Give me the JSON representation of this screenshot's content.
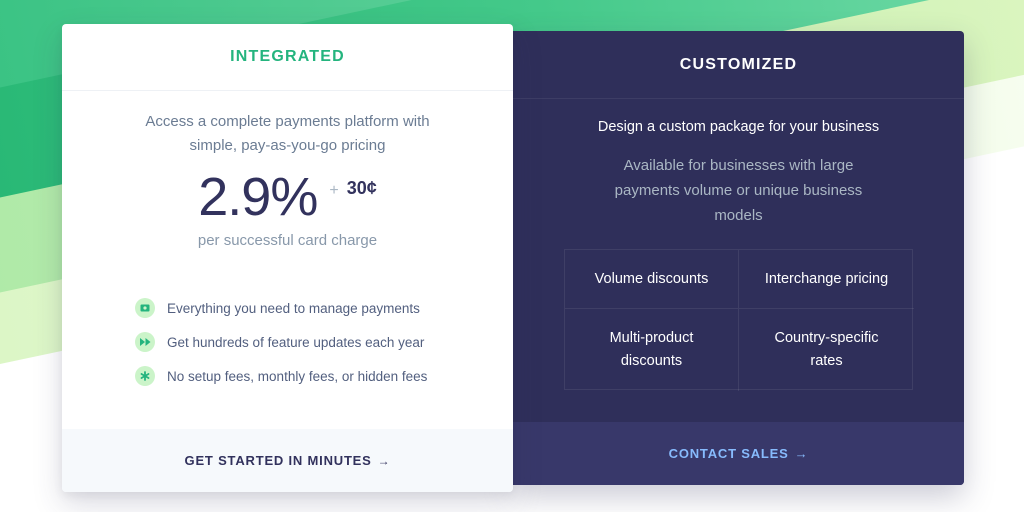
{
  "integrated": {
    "title": "INTEGRATED",
    "description": "Access a complete payments platform with simple, pay-as-you-go pricing",
    "price_percent": "2.9%",
    "price_plus": "+",
    "price_fixed": "30¢",
    "price_caption": "per successful card charge",
    "features": [
      {
        "icon": "money-icon",
        "glyph": "▣",
        "text": "Everything you need to manage payments"
      },
      {
        "icon": "fast-forward-icon",
        "glyph": "▸▸",
        "text": "Get hundreds of feature updates each year"
      },
      {
        "icon": "asterisk-icon",
        "glyph": "✱",
        "text": "No setup fees, monthly fees, or hidden fees"
      }
    ],
    "cta": "GET STARTED IN MINUTES",
    "cta_arrow": "→"
  },
  "customized": {
    "title": "CUSTOMIZED",
    "lead": "Design a custom package for your business",
    "description": "Available for businesses with large payments volume or unique business models",
    "options": [
      "Volume discounts",
      "Interchange pricing",
      "Multi-product discounts",
      "Country-specific rates"
    ],
    "cta": "CONTACT SALES",
    "cta_arrow": "→"
  },
  "colors": {
    "accent_green": "#24b47e",
    "dark_card": "#2f2f5a",
    "link_blue": "#87bbfd"
  }
}
